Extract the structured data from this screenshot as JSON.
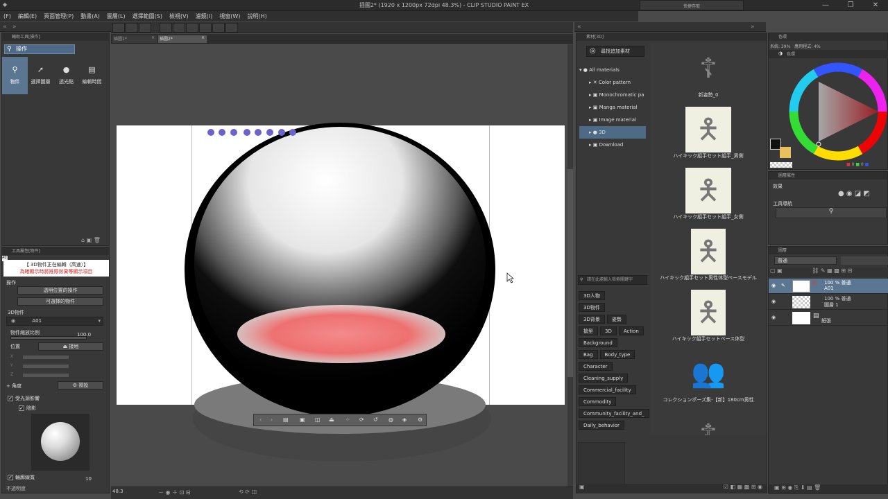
{
  "window": {
    "title": "插圖2* (1920 x 1200px 72dpi 48.3%) - CLIP STUDIO PAINT EX",
    "quick_access": "快捷存取",
    "minimize": "—",
    "maximize": "❐",
    "close": "✕"
  },
  "menu": [
    "(F)",
    "編輯(E)",
    "頁面管理(P)",
    "動畫(A)",
    "圖層(L)",
    "選擇範圍(S)",
    "檢視(V)",
    "濾鏡(I)",
    "視窗(W)",
    "說明(H)"
  ],
  "canvas_tabs": [
    "插圖1*",
    "插圖2*"
  ],
  "subtool_panel": {
    "title": "輔助工具[操作]",
    "group": "操作",
    "tools": [
      "物件",
      "選擇圖層",
      "透光點",
      "編輯時間"
    ]
  },
  "tool_property": {
    "title": "工具屬性[物件]",
    "notice1": "【 3D物件正在編輯（高速）】",
    "notice2": "為確顯示時將推際效果等顯示項目",
    "operation_label": "操作",
    "op_select1": "透明位置的操作",
    "op_select2": "可選擇的物件",
    "object_section": "3D物件",
    "object_name": "A01",
    "scale_label": "物件縮放比例",
    "scale_value": "100.0",
    "position_label": "位置",
    "ground_btn": "接地",
    "x": "X",
    "y": "Y",
    "z": "Z",
    "angle_label": "角度",
    "preset_btn": "預設",
    "light_label": "受光源影響",
    "shadow_label": "陰影",
    "outline_label": "輪廓線寬",
    "outline_value": "10",
    "opacity_label": "不透明度"
  },
  "statusbar": {
    "zoom": "48.3"
  },
  "material_panel": {
    "title": "素材[3D]",
    "search_btn": "尋找追加素材",
    "tree": [
      "All materials",
      "Color pattern",
      "Monochromatic pa",
      "Manga material",
      "Image material",
      "3D",
      "Download"
    ],
    "search_placeholder": "請在此處輸入檢索關鍵字",
    "tags": [
      [
        "3D人物"
      ],
      [
        "3D物件"
      ],
      [
        "3D背景",
        "姿勢"
      ],
      [
        "搶型",
        "3D",
        "Action"
      ],
      [
        "Background"
      ],
      [
        "Bag",
        "Body_type"
      ],
      [
        "Character"
      ],
      [
        "Cleaning_supply"
      ],
      [
        "Commercial_facility"
      ],
      [
        "Commodity"
      ],
      [
        "Community_facility_and_"
      ],
      [
        "Daily_behavior"
      ]
    ],
    "items": [
      "新姿勢_0",
      "ハイキック組手セット組手_男側",
      "ハイキック組手セット組手_女側",
      "ハイキック組手セット男性体型ベースモデル",
      "ハイキック組手セットベース体型",
      "コレクションポーズ集-【新】180cm男性"
    ]
  },
  "color_panel": {
    "title": "色環",
    "info": "系統: 39%　應用程式: 4%",
    "accent": "#e8303a",
    "main_color": "#111111",
    "sub_color": "#e8c060"
  },
  "layer_prop": {
    "title": "圖層屬性",
    "effect": "效果",
    "tool_nav": "工具導航"
  },
  "layers": {
    "title": "圖層",
    "blend": "普通",
    "rows": [
      {
        "mode": "100 % 普通",
        "name": "A01"
      },
      {
        "mode": "100 % 普通",
        "name": "圖層 1"
      },
      {
        "mode": "",
        "name": "紙張"
      }
    ]
  }
}
